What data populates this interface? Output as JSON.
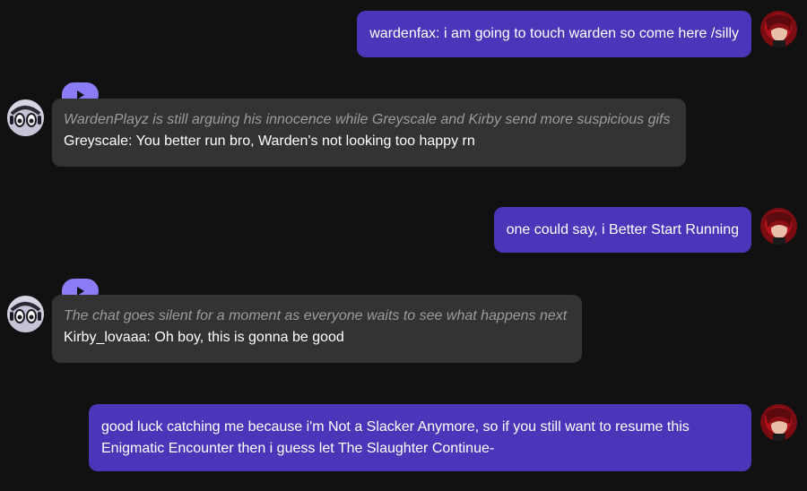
{
  "messages": [
    {
      "role": "user",
      "text": "wardenfax: i am going to touch warden so come here /silly"
    },
    {
      "role": "bot",
      "narration": "WardenPlayz is still arguing his innocence while Greyscale and Kirby send more suspicious gifs",
      "text": "Greyscale: You better run bro, Warden's not looking too happy rn"
    },
    {
      "role": "user",
      "text": "one could say, i Better Start Running"
    },
    {
      "role": "bot",
      "narration": "The chat goes silent for a moment as everyone waits to see what happens next",
      "text": "Kirby_lovaaa: Oh boy, this is gonna be good"
    },
    {
      "role": "user",
      "lines": [
        "good luck catching me because i'm Not a Slacker Anymore, so if you still want to resume this",
        "Enigmatic Encounter then i guess let The Slaughter Continue-"
      ]
    }
  ],
  "icons": {
    "play": "play-icon",
    "user_avatar": "user-avatar",
    "bot_avatar": "bot-avatar"
  },
  "colors": {
    "user_bubble": "#4a36b8",
    "bot_bubble": "#333334",
    "play_button": "#8a7cf4",
    "narration_text": "#9b9ba0",
    "background": "#111112"
  }
}
